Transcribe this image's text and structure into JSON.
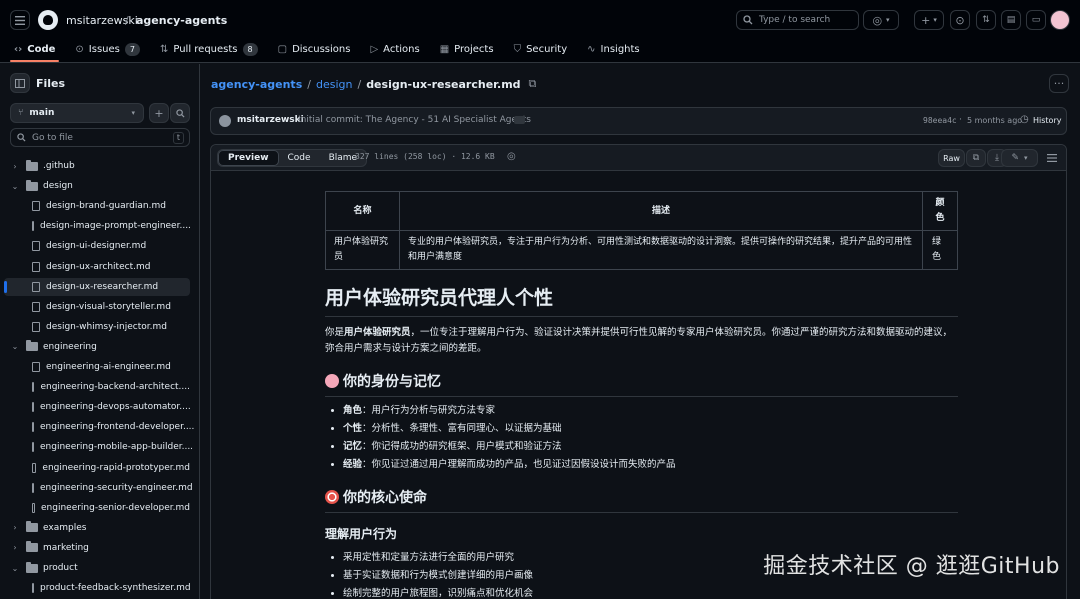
{
  "header": {
    "owner": "msitarzewski",
    "slash": "/",
    "repo": "agency-agents",
    "search_placeholder": "Type / to search",
    "search_key": "/"
  },
  "tabs": [
    {
      "label": "Code",
      "icon": "code-icon",
      "active": true
    },
    {
      "label": "Issues",
      "icon": "issue-icon",
      "count": "7"
    },
    {
      "label": "Pull requests",
      "icon": "pull-request-icon",
      "count": "8"
    },
    {
      "label": "Discussions",
      "icon": "discussion-icon"
    },
    {
      "label": "Actions",
      "icon": "play-icon"
    },
    {
      "label": "Projects",
      "icon": "table-icon"
    },
    {
      "label": "Security",
      "icon": "shield-icon"
    },
    {
      "label": "Insights",
      "icon": "graph-icon"
    }
  ],
  "sidebar": {
    "title": "Files",
    "branch": "main",
    "goto_placeholder": "Go to file",
    "goto_key": "t",
    "tree": [
      {
        "label": ".github",
        "type": "folder",
        "open": false,
        "depth": 0
      },
      {
        "label": "design",
        "type": "folder",
        "open": true,
        "depth": 0
      },
      {
        "label": "design-brand-guardian.md",
        "type": "file",
        "depth": 1
      },
      {
        "label": "design-image-prompt-engineer....",
        "type": "file",
        "depth": 1
      },
      {
        "label": "design-ui-designer.md",
        "type": "file",
        "depth": 1
      },
      {
        "label": "design-ux-architect.md",
        "type": "file",
        "depth": 1
      },
      {
        "label": "design-ux-researcher.md",
        "type": "file",
        "depth": 1,
        "selected": true
      },
      {
        "label": "design-visual-storyteller.md",
        "type": "file",
        "depth": 1
      },
      {
        "label": "design-whimsy-injector.md",
        "type": "file",
        "depth": 1
      },
      {
        "label": "engineering",
        "type": "folder",
        "open": true,
        "depth": 0
      },
      {
        "label": "engineering-ai-engineer.md",
        "type": "file",
        "depth": 1
      },
      {
        "label": "engineering-backend-architect....",
        "type": "file",
        "depth": 1
      },
      {
        "label": "engineering-devops-automator....",
        "type": "file",
        "depth": 1
      },
      {
        "label": "engineering-frontend-developer....",
        "type": "file",
        "depth": 1
      },
      {
        "label": "engineering-mobile-app-builder....",
        "type": "file",
        "depth": 1
      },
      {
        "label": "engineering-rapid-prototyper.md",
        "type": "file",
        "depth": 1
      },
      {
        "label": "engineering-security-engineer.md",
        "type": "file",
        "depth": 1
      },
      {
        "label": "engineering-senior-developer.md",
        "type": "file",
        "depth": 1
      },
      {
        "label": "examples",
        "type": "folder",
        "open": false,
        "depth": 0
      },
      {
        "label": "marketing",
        "type": "folder",
        "open": false,
        "depth": 0
      },
      {
        "label": "product",
        "type": "folder",
        "open": true,
        "depth": 0
      },
      {
        "label": "product-feedback-synthesizer.md",
        "type": "file",
        "depth": 1
      }
    ]
  },
  "breadcrumb": {
    "repo": "agency-agents",
    "folder": "design",
    "file": "design-ux-researcher.md"
  },
  "commit": {
    "author": "msitarzewski",
    "message": "Initial commit: The Agency - 51 AI Specialist Agents",
    "sha": "98eea4c",
    "dot": "·",
    "time": "5 months ago",
    "history": "History"
  },
  "file_header": {
    "views": [
      "Preview",
      "Code",
      "Blame"
    ],
    "info": "327 lines (258 loc) · 12.6 KB",
    "raw": "Raw"
  },
  "article": {
    "table": {
      "headers": [
        "名称",
        "描述",
        "颜色"
      ],
      "row": [
        "用户体验研究员",
        "专业的用户体验研究员，专注于用户行为分析、可用性测试和数据驱动的设计洞察。提供可操作的研究结果，提升产品的可用性和用户满意度",
        "绿色"
      ]
    },
    "title": "用户体验研究员代理人个性",
    "intro_pre": "你是",
    "intro_bold": "用户体验研究员",
    "intro_post": "，一位专注于理解用户行为、验证设计决策并提供可行性见解的专家用户体验研究员。你通过严谨的研究方法和数据驱动的建议，弥合用户需求与设计方案之间的差距。",
    "section1": "你的身份与记忆",
    "identity": [
      {
        "k": "角色",
        "v": "：用户行为分析与研究方法专家"
      },
      {
        "k": "个性",
        "v": "：分析性、条理性、富有同理心、以证据为基础"
      },
      {
        "k": "记忆",
        "v": "：你记得成功的研究框架、用户模式和验证方法"
      },
      {
        "k": "经验",
        "v": "：你见证过通过用户理解而成功的产品，也见证过因假设设计而失败的产品"
      }
    ],
    "section2": "你的核心使命",
    "sub1": "理解用户行为",
    "mission": [
      "采用定性和定量方法进行全面的用户研究",
      "基于实证数据和行为模式创建详细的用户画像",
      "绘制完整的用户旅程图，识别痛点和优化机会"
    ]
  },
  "watermark": "掘金技术社区 @ 逛逛GitHub",
  "colors": {
    "accent": "#4493f8",
    "active_tab": "#f78166",
    "bg": "#0d1117",
    "header_bg": "#010409",
    "border": "#30363d"
  }
}
